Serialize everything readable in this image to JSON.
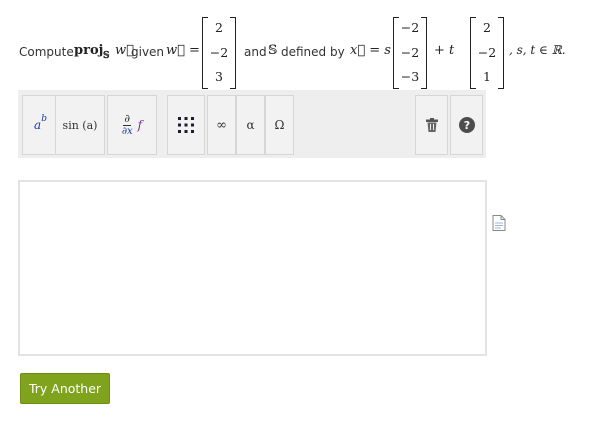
{
  "problem": {
    "intro": "Compute",
    "proj_label": "proj",
    "proj_sub": "𝕊",
    "w_symbol": "w⃗",
    "given": "given",
    "w_eq": "w⃗ =",
    "w_vector": [
      "2",
      "−2",
      "3"
    ],
    "and_text": "and",
    "set_symbol": "𝕊",
    "defined_by": "defined by",
    "x_eq": "x⃗ = s",
    "v1": [
      "−2",
      "−2",
      "−3"
    ],
    "plus_t": "+ t",
    "v2": [
      "2",
      "−2",
      "1"
    ],
    "tail": ", s, t ∈ ℝ."
  },
  "toolbar": {
    "superscript": {
      "base": "a",
      "exp": "b"
    },
    "function": "sin (a)",
    "partial": {
      "num": "∂",
      "den": "∂x",
      "f": "f"
    },
    "infinity": "∞",
    "alpha": "α",
    "omega": "Ω"
  },
  "actions": {
    "try_another": "Try Another"
  },
  "colors": {
    "button_green": "#7fa31c",
    "accent_blue": "#1a3aa8",
    "accent_purple": "#7b2a9a"
  },
  "icons": [
    "matrix-icon",
    "trash-icon",
    "help-icon",
    "document-icon"
  ]
}
